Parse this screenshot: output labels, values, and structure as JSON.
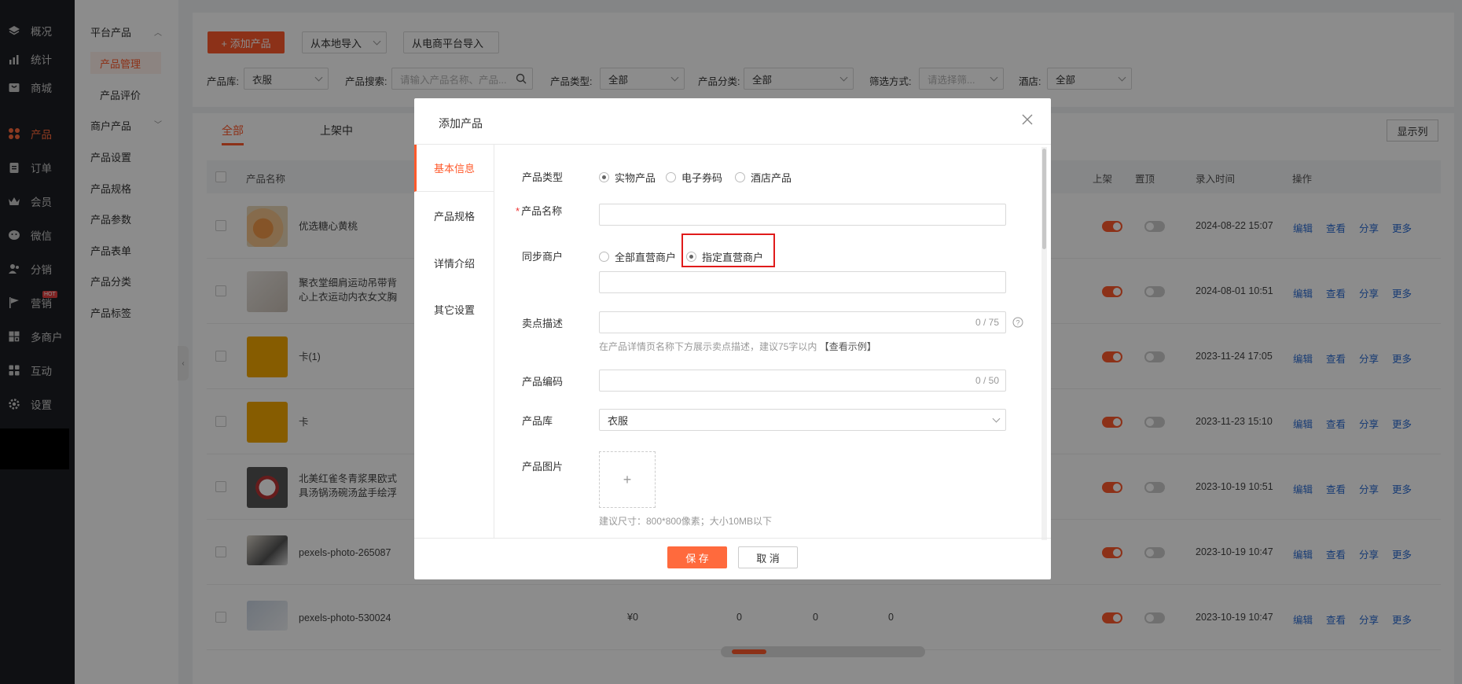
{
  "sidebar": {
    "items": [
      {
        "label": "概况",
        "icon": "layers-icon"
      },
      {
        "label": "统计",
        "icon": "stats-icon"
      },
      {
        "label": "商城",
        "icon": "shop-icon"
      },
      {
        "label": "产品",
        "icon": "grid-icon"
      },
      {
        "label": "订单",
        "icon": "order-icon"
      },
      {
        "label": "会员",
        "icon": "crown-icon"
      },
      {
        "label": "微信",
        "icon": "wechat-icon"
      },
      {
        "label": "分销",
        "icon": "users-icon"
      },
      {
        "label": "营销",
        "icon": "flag-icon",
        "badge": "HOT"
      },
      {
        "label": "多商户",
        "icon": "store-icon"
      },
      {
        "label": "互动",
        "icon": "apps-icon"
      },
      {
        "label": "设置",
        "icon": "gear-icon"
      }
    ]
  },
  "submenu": {
    "platform_group": "平台产品",
    "product_manage": "产品管理",
    "product_review": "产品评价",
    "merchant_group": "商户产品",
    "product_settings": "产品设置",
    "product_spec": "产品规格",
    "product_params": "产品参数",
    "product_form": "产品表单",
    "product_category": "产品分类",
    "product_tags": "产品标签"
  },
  "toolbar": {
    "add_product": "+ 添加产品",
    "import_local": "从本地导入",
    "import_ecommerce": "从电商平台导入"
  },
  "filters": {
    "library_label": "产品库:",
    "library_value": "衣服",
    "search_label": "产品搜索:",
    "search_placeholder": "请输入产品名称、产品...",
    "type_label": "产品类型:",
    "type_value": "全部",
    "category_label": "产品分类:",
    "category_value": "全部",
    "filter_label": "筛选方式:",
    "filter_placeholder": "请选择筛...",
    "hotel_label": "酒店:",
    "hotel_value": "全部"
  },
  "tabs": {
    "all": "全部",
    "on_sale": "上架中",
    "show_columns": "显示列"
  },
  "table": {
    "headers": {
      "name": "产品名称",
      "listed": "上架",
      "pinned": "置顶",
      "entry_time": "录入时间",
      "actions": "操作"
    },
    "rows": [
      {
        "name": "优选糖心黄桃",
        "time": "2024-08-22 15:07"
      },
      {
        "name": "聚衣堂细肩运动吊带背心上衣运动内衣女文胸",
        "time": "2024-08-01 10:51"
      },
      {
        "name": "卡(1)",
        "time": "2023-11-24 17:05"
      },
      {
        "name": "卡",
        "time": "2023-11-23 15:10"
      },
      {
        "name": "北美红雀冬青浆果欧式具汤锅汤碗汤盆手绘浮雕",
        "time": "2023-10-19 10:51"
      },
      {
        "name": "pexels-photo-265087",
        "time": "2023-10-19 10:47"
      },
      {
        "name": "pexels-photo-530024",
        "time": "2023-10-19 10:47",
        "price": "¥0",
        "c1": "0",
        "c2": "0",
        "c3": "0"
      }
    ],
    "actions": {
      "edit": "编辑",
      "view": "查看",
      "share": "分享",
      "more": "更多"
    }
  },
  "modal": {
    "title": "添加产品",
    "nav": {
      "basic": "基本信息",
      "spec": "产品规格",
      "detail": "详情介绍",
      "other": "其它设置"
    },
    "fields": {
      "type_label": "产品类型",
      "type_options": [
        "实物产品",
        "电子券码",
        "酒店产品"
      ],
      "name_label": "产品名称",
      "sync_label": "同步商户",
      "sync_options": [
        "全部直营商户",
        "指定直营商户"
      ],
      "selling_label": "卖点描述",
      "selling_count": "0 / 75",
      "selling_hint": "在产品详情页名称下方展示卖点描述，建议75字以内",
      "selling_example": "【查看示例】",
      "code_label": "产品编码",
      "code_count": "0 / 50",
      "library_label": "产品库",
      "library_value": "衣服",
      "image_label": "产品图片",
      "image_hint": "建议尺寸：800*800像素；大小10MB以下"
    },
    "save": "保 存",
    "cancel": "取 消"
  },
  "colors": {
    "accent": "#ff5a2c",
    "sidebar_bg": "#1d1e23",
    "highlight_box": "#e01b1b"
  }
}
